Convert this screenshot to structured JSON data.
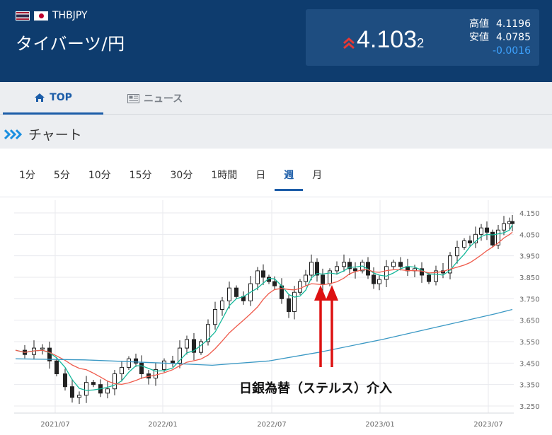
{
  "header": {
    "symbol": "THBJPY",
    "name": "タイバーツ/円",
    "price_main": "4.103",
    "price_small": "2",
    "high_label": "高値",
    "high_value": "4.1196",
    "low_label": "安値",
    "low_value": "4.0785",
    "change": "-0.0016",
    "colors": {
      "header_bg": "#0e3c6e",
      "up_arrow": "#e53935",
      "change": "#3ea3ff"
    }
  },
  "tabs": [
    {
      "label": "TOP",
      "icon": "home-icon",
      "active": true
    },
    {
      "label": "ニュース",
      "icon": "news-icon",
      "active": false
    }
  ],
  "section": {
    "title": "チャート",
    "icon": "chevrons-right-icon"
  },
  "periods": [
    "1分",
    "5分",
    "10分",
    "15分",
    "30分",
    "1時間",
    "日",
    "週",
    "月"
  ],
  "active_period": "週",
  "chart_data": {
    "type": "candlestick",
    "y_ticks": [
      "4.150",
      "4.050",
      "3.950",
      "3.850",
      "3.750",
      "3.650",
      "3.550",
      "3.450",
      "3.350",
      "3.250"
    ],
    "x_ticks": [
      "2021/07",
      "2022/01",
      "2022/07",
      "2023/01",
      "2023/07"
    ],
    "ylim": [
      3.22,
      4.18
    ],
    "annotation": "日銀為替（ステルス）介入",
    "ma_colors": {
      "short": "#14b89a",
      "mid": "#ef5b4c",
      "long": "#3a98c4"
    },
    "candle_color": "#222222",
    "annotation_color": "#dd1111"
  }
}
